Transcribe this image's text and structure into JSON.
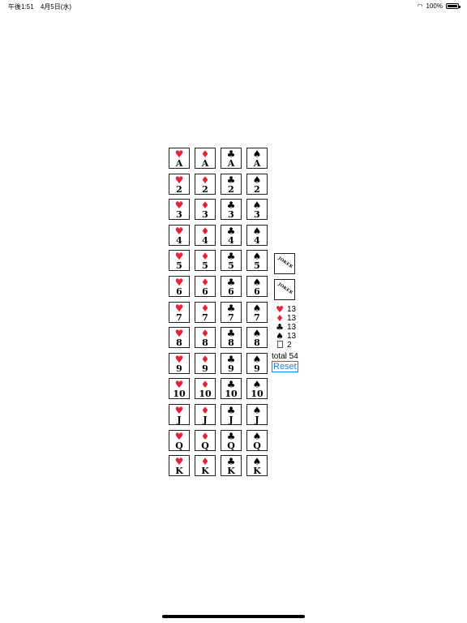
{
  "status_bar": {
    "time": "午後1:51",
    "date": "4月5日(水)",
    "battery": "100%",
    "wifi_icon": "wifi-icon",
    "battery_icon": "battery-icon"
  },
  "suits": [
    {
      "key": "hearts",
      "symbol": "♥",
      "color": "#e8203a"
    },
    {
      "key": "diamonds",
      "symbol": "♦",
      "color": "#e8203a"
    },
    {
      "key": "clubs",
      "symbol": "♣",
      "color": "#000000"
    },
    {
      "key": "spades",
      "symbol": "♠",
      "color": "#000000"
    }
  ],
  "ranks": [
    "A",
    "2",
    "3",
    "4",
    "5",
    "6",
    "7",
    "8",
    "9",
    "10",
    "J",
    "Q",
    "K"
  ],
  "jokers": [
    {
      "label": "JOKER"
    },
    {
      "label": "JOKER"
    }
  ],
  "counts": {
    "hearts": "13",
    "diamonds": "13",
    "clubs": "13",
    "spades": "13",
    "jokers": "2",
    "total_label": "total 54"
  },
  "reset_label": "Reset"
}
